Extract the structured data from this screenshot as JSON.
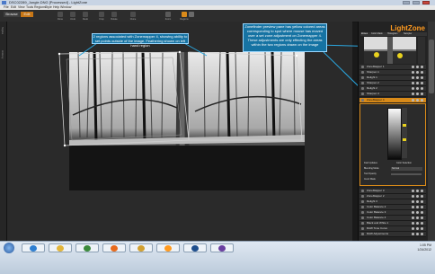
{
  "window": {
    "title": "DSC02289_Jungle.DNG [Processed] - LightZone",
    "controls": [
      "–",
      "□",
      "✕"
    ]
  },
  "menu": [
    "File",
    "Edit",
    "View",
    "Tools",
    "Regions",
    "Style",
    "Help",
    "Window"
  ],
  "toolbar": {
    "browse_label": "Browse",
    "edit_label": "Edit",
    "tools": [
      {
        "label": "Done",
        "icon": "done-icon"
      },
      {
        "label": "Undo",
        "icon": "undo-icon"
      },
      {
        "label": "Redo",
        "icon": "redo-icon"
      },
      {
        "label": "Crop",
        "icon": "crop-icon"
      },
      {
        "label": "Rotate",
        "icon": "rotate-icon"
      },
      {
        "label": "Clone",
        "icon": "clone-icon"
      },
      {
        "label": "Zoom",
        "icon": "zoom-icon"
      },
      {
        "label": "Regions",
        "icon": "region-icon"
      }
    ]
  },
  "left_strip": {
    "styles_label": "Styles",
    "history_label": "History"
  },
  "callouts": {
    "left": "2 regions associated with Zonemapper 4, showing ability to set points outside of the image. Feathering shown on left hand region",
    "right": "Zonefinder preview pane has yellow colored areas corresponding to spot where mouse has moved over a set zone adjustment on Zonemapper 4. These adjustments are only effecting the areas within the two regions drawn on the image"
  },
  "panel": {
    "logo": "LightZone",
    "tabs": [
      "Zones",
      "Color Mask",
      "Histogram",
      "Sampler"
    ],
    "top_rows": [
      "ZoneMapper 1",
      "Sharpen 1",
      "Relight 1",
      "Sharpen 2",
      "Relight 2",
      "Sharpen 4"
    ],
    "active_tool": "ZoneMapper 4",
    "options": [
      "Fast Updates",
      "Color Selection",
      "Blending Mode",
      "Tool Opacity",
      "Invert Mask"
    ],
    "blend_value": "Normal",
    "bottom_rows": [
      "ZoneMapper 3",
      "ZoneMapper 2",
      "Relight 3",
      "Color Balance 2",
      "Color Balance 3",
      "Color Balance 4",
      "Black and White 1",
      "RAW Tone Curve",
      "RAW Adjustments"
    ]
  },
  "taskbar": {
    "apps": [
      "start",
      "ie",
      "explorer",
      "media",
      "firefox",
      "folder",
      "lightzone",
      "photoshop",
      "other"
    ],
    "clock": "1:05 PM",
    "date": "1/24/2012"
  },
  "colors": {
    "accent": "#ff9a1f",
    "callout_bg": "#1673a3",
    "callout_border": "#9bd8ff",
    "active_row": "#d88a19"
  }
}
